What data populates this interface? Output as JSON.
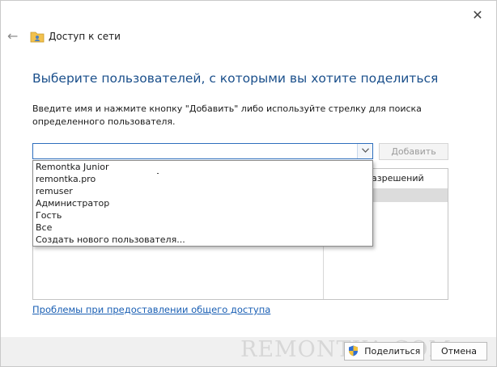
{
  "window": {
    "close_glyph": "✕",
    "back_glyph": "←",
    "title": "Доступ к сети",
    "title_icon": "shared-folder-users-icon"
  },
  "main": {
    "heading": "Выберите пользователей, с которыми вы хотите поделиться",
    "instructions": "Введите имя и нажмите кнопку \"Добавить\" либо используйте стрелку для поиска определенного пользователя.",
    "combo_value": "",
    "add_label": "Добавить",
    "permissions_header": "азрешений",
    "dropdown_items": [
      "Remontka Junior",
      "remontka.pro",
      "remuser",
      "Администратор",
      "Гость",
      "Все",
      "Создать нового пользователя..."
    ],
    "problems_link": "Проблемы при предоставлении общего доступа"
  },
  "footer": {
    "watermark": "REMONTKA.COM",
    "share_label": "Поделиться",
    "cancel_label": "Отмена"
  },
  "colors": {
    "heading": "#1a4f8b",
    "link": "#1a5fb4",
    "combo_border": "#2e6ebd"
  }
}
